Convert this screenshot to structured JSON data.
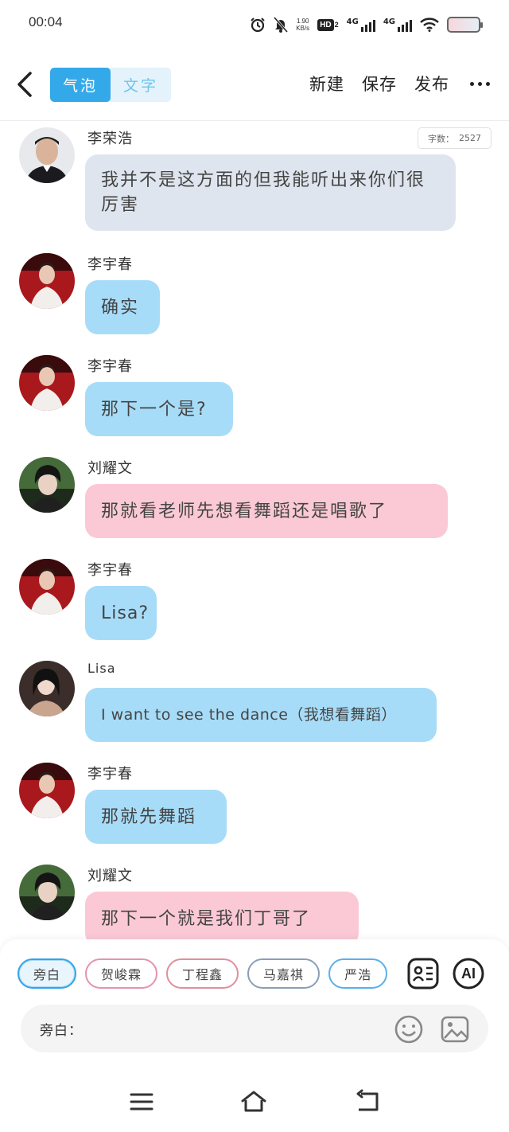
{
  "status_bar": {
    "time": "00:04",
    "net_speed": "1.90",
    "net_unit": "KB/s",
    "hd_label": "HD",
    "hd_sub": "2",
    "signal1": "4G",
    "signal2": "4G"
  },
  "toolbar": {
    "tabs": [
      {
        "label": "气泡",
        "active": true
      },
      {
        "label": "文字",
        "active": false
      }
    ],
    "new_label": "新建",
    "save_label": "保存",
    "publish_label": "发布"
  },
  "word_count": {
    "label": "字数：",
    "value": "2527"
  },
  "messages": [
    {
      "name": "李荣浩",
      "text": "我并不是这方面的但我能听出来你们很厉害",
      "color": "gray"
    },
    {
      "name": "李宇春",
      "text": "确实",
      "color": "blue"
    },
    {
      "name": "李宇春",
      "text": "那下一个是?",
      "color": "blue"
    },
    {
      "name": "刘耀文",
      "text": "那就看老师先想看舞蹈还是唱歌了",
      "color": "pink"
    },
    {
      "name": "李宇春",
      "text": "Lisa?",
      "color": "blue"
    },
    {
      "name": "Lisa",
      "text": "I want to see the dance（我想看舞蹈）",
      "color": "blue"
    },
    {
      "name": "李宇春",
      "text": "那就先舞蹈",
      "color": "blue"
    },
    {
      "name": "刘耀文",
      "text": "那下一个就是我们丁哥了",
      "color": "pink"
    }
  ],
  "characters": [
    "旁白",
    "贺峻霖",
    "丁程鑫",
    "马嘉祺",
    "严浩"
  ],
  "ai_label": "AI",
  "input": {
    "label": "旁白：",
    "value": "",
    "placeholder": ""
  },
  "colors": {
    "accent": "#33a9ea",
    "bubble_gray": "#dfe5ee",
    "bubble_blue": "#a7dcf8",
    "bubble_pink": "#fac9d5"
  }
}
